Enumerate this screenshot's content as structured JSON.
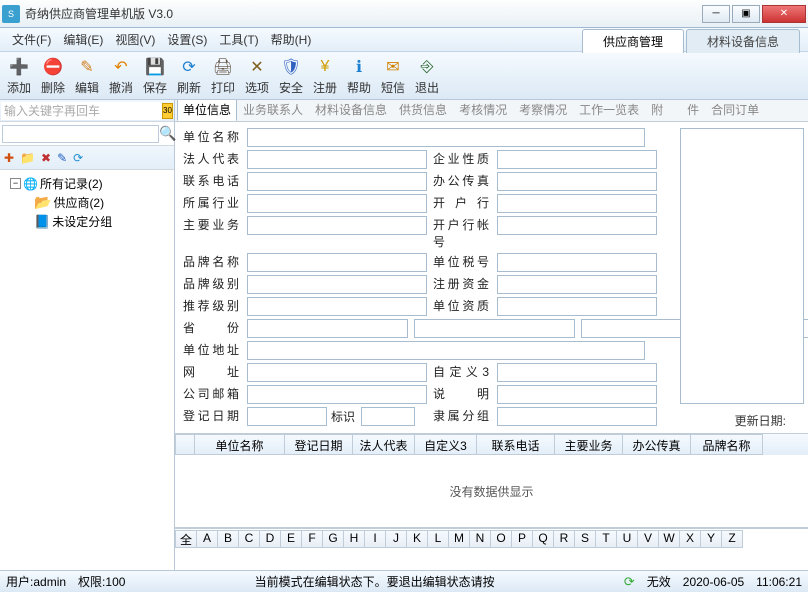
{
  "title": "奇纳供应商管理单机版 V3.0",
  "menu": [
    "文件(F)",
    "编辑(E)",
    "视图(V)",
    "设置(S)",
    "工具(T)",
    "帮助(H)"
  ],
  "main_tabs": [
    {
      "label": "供应商管理",
      "active": true
    },
    {
      "label": "材料设备信息",
      "active": false
    }
  ],
  "toolbar": [
    {
      "label": "添加",
      "glyph": "➕",
      "color": "#2a8a2a"
    },
    {
      "label": "删除",
      "glyph": "⛔",
      "color": "#c03030"
    },
    {
      "label": "编辑",
      "glyph": "✎",
      "color": "#d08020"
    },
    {
      "label": "撤消",
      "glyph": "↶",
      "color": "#e08000"
    },
    {
      "label": "保存",
      "glyph": "💾",
      "color": "#3060a0"
    },
    {
      "label": "刷新",
      "glyph": "⟳",
      "color": "#2080d0"
    },
    {
      "label": "打印",
      "glyph": "🖨",
      "color": "#605040"
    },
    {
      "label": "选项",
      "glyph": "✕",
      "color": "#806020"
    },
    {
      "label": "安全",
      "glyph": "🛡",
      "color": "#3060c0"
    },
    {
      "label": "注册",
      "glyph": "¥",
      "color": "#d0a000"
    },
    {
      "label": "帮助",
      "glyph": "ℹ",
      "color": "#2080d0"
    },
    {
      "label": "短信",
      "glyph": "✉",
      "color": "#d08000"
    },
    {
      "label": "退出",
      "glyph": "⎆",
      "color": "#206020"
    }
  ],
  "search_placeholder": "输入关键字再回车",
  "cal_badge": "30",
  "tree": {
    "root": "所有记录(2)",
    "children": [
      {
        "label": "供应商(2)",
        "icon": "folder"
      },
      {
        "label": "未设定分组",
        "icon": "book"
      }
    ]
  },
  "sub_tabs": [
    "单位信息",
    "业务联系人",
    "材料设备信息",
    "供货信息",
    "考核情况",
    "考察情况",
    "工作一览表",
    "附　　件",
    "合同订单"
  ],
  "form_labels": {
    "c1": [
      "单位名称",
      "法人代表",
      "联系电话",
      "所属行业",
      "主要业务",
      "品牌名称",
      "品牌级别",
      "推荐级别",
      "省　份",
      "单位地址",
      "网　址",
      "公司邮箱",
      "登记日期"
    ],
    "c2": [
      "",
      "企业性质",
      "办公传真",
      "开 户 行",
      "开户行帐号",
      "单位税号",
      "注册资金",
      "单位资质",
      "",
      "",
      "自定义3",
      "说　明",
      "隶属分组"
    ],
    "biaoshi": "标识"
  },
  "update_label": "更新日期:",
  "grid_headers": [
    "",
    "单位名称",
    "登记日期",
    "法人代表",
    "自定义3",
    "联系电话",
    "主要业务",
    "办公传真",
    "品牌名称"
  ],
  "grid_empty": "没有数据供显示",
  "alpha_all": "全",
  "alpha": [
    "A",
    "B",
    "C",
    "D",
    "E",
    "F",
    "G",
    "H",
    "I",
    "J",
    "K",
    "L",
    "M",
    "N",
    "O",
    "P",
    "Q",
    "R",
    "S",
    "T",
    "U",
    "V",
    "W",
    "X",
    "Y",
    "Z"
  ],
  "status": {
    "user_label": "用户:",
    "user_value": "admin",
    "perm_label": "权限:",
    "perm_value": "100",
    "mode": "当前模式在编辑状态下。要退出编辑状态请按",
    "invalid": "无效",
    "date": "2020-06-05",
    "time": "11:06:21"
  }
}
